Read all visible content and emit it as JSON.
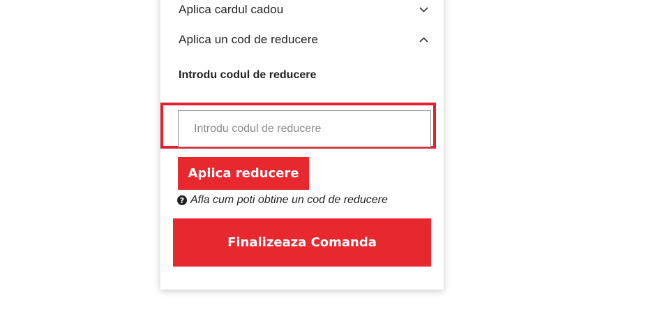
{
  "accordion": {
    "gift_card_label": "Aplica cardul cadou",
    "discount_label": "Aplica un cod de reducere"
  },
  "discount": {
    "section_title": "Introdu codul de reducere",
    "input_placeholder": "Introdu codul de reducere",
    "input_value": "",
    "apply_label": "Aplica reducere",
    "help_text": "Afla cum poti obtine un cod de reducere"
  },
  "checkout": {
    "label": "Finalizeaza Comanda"
  },
  "icons": {
    "gift_chevron": "chevron-down-icon",
    "discount_chevron": "chevron-up-icon",
    "help": "question-circle-icon"
  },
  "colors": {
    "accent": "#e8282f",
    "highlight_border": "#e3202f",
    "text": "#222222"
  }
}
